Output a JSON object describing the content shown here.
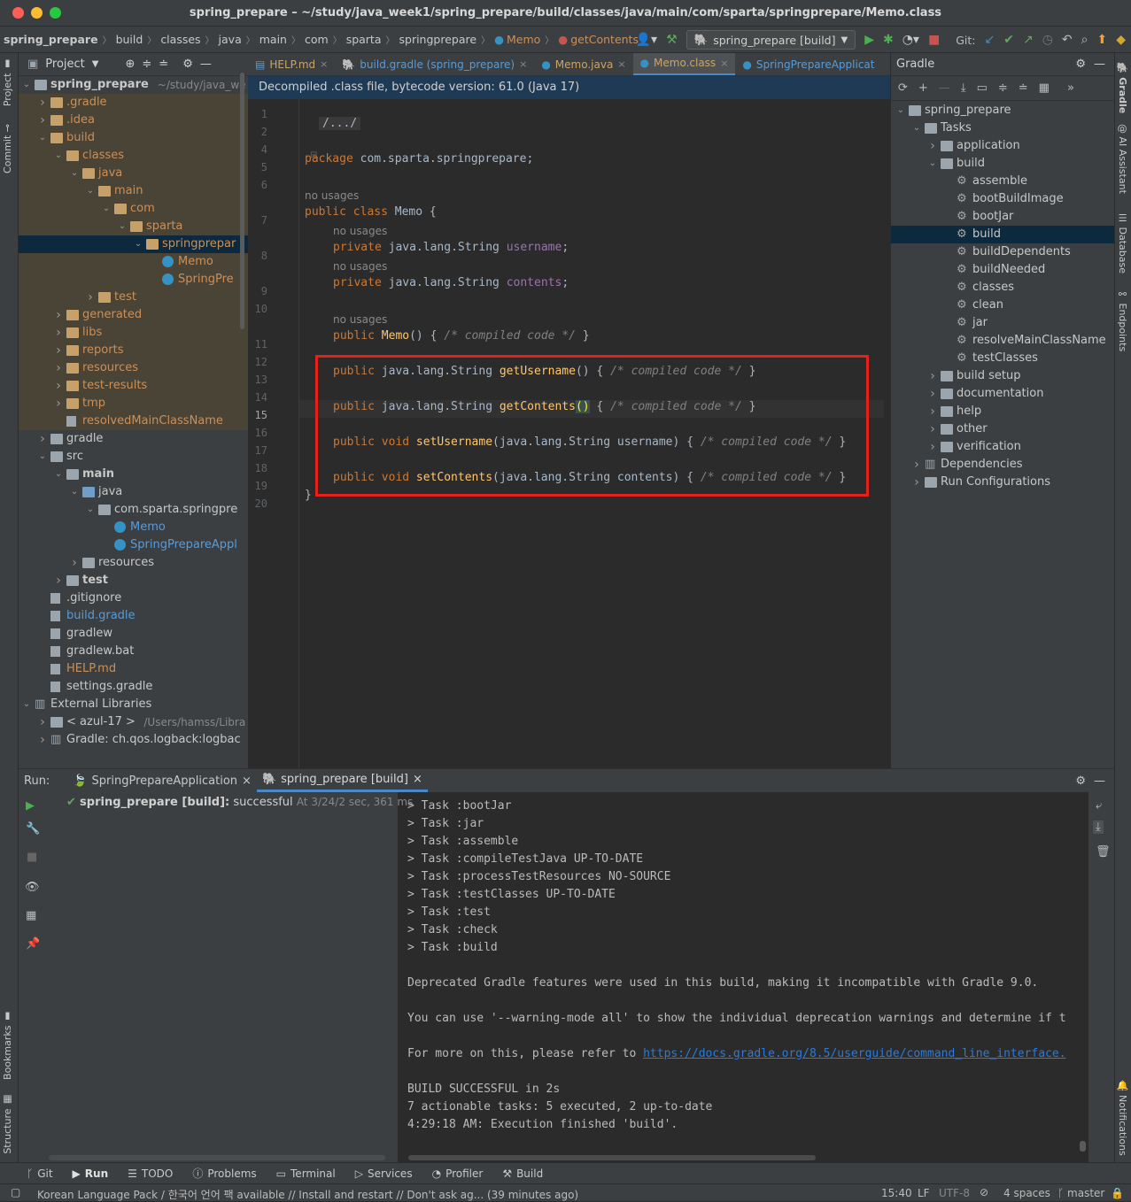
{
  "window": {
    "title": "spring_prepare – ~/study/java_week1/spring_prepare/build/classes/java/main/com/sparta/springprepare/Memo.class"
  },
  "navbar": {
    "crumbs": [
      "spring_prepare",
      "build",
      "classes",
      "java",
      "main",
      "com",
      "sparta",
      "springprepare"
    ],
    "crumb_class": "Memo",
    "crumb_method": "getContents",
    "run_config": "spring_prepare [build]",
    "git_label": "Git:"
  },
  "left_strip": {
    "project": "Project",
    "commit": "Commit",
    "bookmarks": "Bookmarks",
    "structure": "Structure"
  },
  "right_strip": {
    "gradle": "Gradle",
    "ai": "AI Assistant",
    "database": "Database",
    "endpoints": "Endpoints",
    "notifications": "Notifications"
  },
  "project": {
    "title": "Project",
    "items": [
      {
        "label": "spring_prepare",
        "extra": "~/study/java_we",
        "depth": 0,
        "arrow": "v",
        "icon": "folder-grey",
        "bold": true
      },
      {
        "label": ".gradle",
        "depth": 1,
        "arrow": ">",
        "icon": "folder",
        "hl": true,
        "orange": true
      },
      {
        "label": ".idea",
        "depth": 1,
        "arrow": ">",
        "icon": "folder",
        "hl": true,
        "orange": true
      },
      {
        "label": "build",
        "depth": 1,
        "arrow": "v",
        "icon": "folder",
        "hl": true,
        "orange": true
      },
      {
        "label": "classes",
        "depth": 2,
        "arrow": "v",
        "icon": "folder",
        "hl": true,
        "orange": true
      },
      {
        "label": "java",
        "depth": 3,
        "arrow": "v",
        "icon": "folder",
        "hl": true,
        "orange": true
      },
      {
        "label": "main",
        "depth": 4,
        "arrow": "v",
        "icon": "folder",
        "hl": true,
        "orange": true
      },
      {
        "label": "com",
        "depth": 5,
        "arrow": "v",
        "icon": "folder",
        "hl": true,
        "orange": true
      },
      {
        "label": "sparta",
        "depth": 6,
        "arrow": "v",
        "icon": "folder",
        "hl": true,
        "orange": true
      },
      {
        "label": "springprepar",
        "depth": 7,
        "arrow": "v",
        "icon": "folder",
        "sel": true,
        "orange": true
      },
      {
        "label": "Memo",
        "depth": 8,
        "arrow": "",
        "icon": "class",
        "hl": true,
        "orange": true
      },
      {
        "label": "SpringPre",
        "depth": 8,
        "arrow": "",
        "icon": "class",
        "hl": true,
        "orange": true
      },
      {
        "label": "test",
        "depth": 4,
        "arrow": ">",
        "icon": "folder",
        "hl": true,
        "orange": true
      },
      {
        "label": "generated",
        "depth": 2,
        "arrow": ">",
        "icon": "folder",
        "hl": true,
        "orange": true
      },
      {
        "label": "libs",
        "depth": 2,
        "arrow": ">",
        "icon": "folder",
        "hl": true,
        "orange": true
      },
      {
        "label": "reports",
        "depth": 2,
        "arrow": ">",
        "icon": "folder",
        "hl": true,
        "orange": true
      },
      {
        "label": "resources",
        "depth": 2,
        "arrow": ">",
        "icon": "folder",
        "hl": true,
        "orange": true
      },
      {
        "label": "test-results",
        "depth": 2,
        "arrow": ">",
        "icon": "folder",
        "hl": true,
        "orange": true
      },
      {
        "label": "tmp",
        "depth": 2,
        "arrow": ">",
        "icon": "folder",
        "hl": true,
        "orange": true
      },
      {
        "label": "resolvedMainClassName",
        "depth": 2,
        "arrow": "",
        "icon": "file",
        "hl": true,
        "orange": true
      },
      {
        "label": "gradle",
        "depth": 1,
        "arrow": ">",
        "icon": "folder-grey"
      },
      {
        "label": "src",
        "depth": 1,
        "arrow": "v",
        "icon": "folder-grey"
      },
      {
        "label": "main",
        "depth": 2,
        "arrow": "v",
        "icon": "folder-grey",
        "bold": true
      },
      {
        "label": "java",
        "depth": 3,
        "arrow": "v",
        "icon": "folder-blue"
      },
      {
        "label": "com.sparta.springpre",
        "depth": 4,
        "arrow": "v",
        "icon": "folder-grey"
      },
      {
        "label": "Memo",
        "depth": 5,
        "arrow": "",
        "icon": "class",
        "blue": true
      },
      {
        "label": "SpringPrepareAppl",
        "depth": 5,
        "arrow": "",
        "icon": "class",
        "blue": true
      },
      {
        "label": "resources",
        "depth": 3,
        "arrow": ">",
        "icon": "folder-grey"
      },
      {
        "label": "test",
        "depth": 2,
        "arrow": ">",
        "icon": "folder-grey",
        "bold": true
      },
      {
        "label": ".gitignore",
        "depth": 1,
        "arrow": "",
        "icon": "file"
      },
      {
        "label": "build.gradle",
        "depth": 1,
        "arrow": "",
        "icon": "file",
        "blue": true
      },
      {
        "label": "gradlew",
        "depth": 1,
        "arrow": "",
        "icon": "file"
      },
      {
        "label": "gradlew.bat",
        "depth": 1,
        "arrow": "",
        "icon": "file"
      },
      {
        "label": "HELP.md",
        "depth": 1,
        "arrow": "",
        "icon": "file",
        "orange": true
      },
      {
        "label": "settings.gradle",
        "depth": 1,
        "arrow": "",
        "icon": "file"
      },
      {
        "label": "External Libraries",
        "depth": 0,
        "arrow": "v",
        "icon": "lib"
      },
      {
        "label": "< azul-17 >",
        "extra": "/Users/hamss/Libra",
        "depth": 1,
        "arrow": ">",
        "icon": "folder-grey"
      },
      {
        "label": "Gradle: ch.qos.logback:logbac",
        "depth": 1,
        "arrow": ">",
        "icon": "lib"
      }
    ]
  },
  "editor": {
    "tabs": [
      {
        "label": "HELP.md",
        "active": false
      },
      {
        "label": "build.gradle (spring_prepare)",
        "active": false
      },
      {
        "label": "Memo.java",
        "active": false
      },
      {
        "label": "Memo.class",
        "active": true
      },
      {
        "label": "SpringPrepareApplicat",
        "active": false
      }
    ],
    "notice": "Decompiled .class file, bytecode version: 61.0 (Java 17)",
    "line_numbers": [
      "1",
      "2",
      "4",
      "5",
      "6",
      "7",
      "8",
      "9",
      "10",
      "11",
      "12",
      "13",
      "14",
      "15",
      "16",
      "17",
      "18",
      "19",
      "20"
    ],
    "hint": "no usages",
    "code": {
      "l2": "/.../",
      "l5_kw": "package",
      "l5_rest": " com.sparta.springprepare;",
      "l7_kw": "public class",
      "l7_rest": " Memo {",
      "l8_kw": "private",
      "l8_type": " java.lang.String ",
      "l8_field": "username",
      "l9_field": "contents",
      "l11_fn": "Memo",
      "l11_rest": "() { ",
      "compiled": "/* compiled code */",
      "l13_fn": "getUsername",
      "l15_fn": "getContents",
      "l17_kw": "public void",
      "l17_fn": "setUsername",
      "l17_params": "(java.lang.String username) { ",
      "l19_fn": "setContents",
      "l19_params": "(java.lang.String contents) { ",
      "l20": "}"
    }
  },
  "gradle": {
    "title": "Gradle",
    "items": [
      {
        "label": "spring_prepare",
        "depth": 0,
        "arrow": "v",
        "icon": "project"
      },
      {
        "label": "Tasks",
        "depth": 1,
        "arrow": "v",
        "icon": "folder"
      },
      {
        "label": "application",
        "depth": 2,
        "arrow": ">",
        "icon": "folder"
      },
      {
        "label": "build",
        "depth": 2,
        "arrow": "v",
        "icon": "folder"
      },
      {
        "label": "assemble",
        "depth": 3,
        "arrow": "",
        "icon": "gear"
      },
      {
        "label": "bootBuildImage",
        "depth": 3,
        "arrow": "",
        "icon": "gear"
      },
      {
        "label": "bootJar",
        "depth": 3,
        "arrow": "",
        "icon": "gear"
      },
      {
        "label": "build",
        "depth": 3,
        "arrow": "",
        "icon": "gear",
        "sel": true
      },
      {
        "label": "buildDependents",
        "depth": 3,
        "arrow": "",
        "icon": "gear"
      },
      {
        "label": "buildNeeded",
        "depth": 3,
        "arrow": "",
        "icon": "gear"
      },
      {
        "label": "classes",
        "depth": 3,
        "arrow": "",
        "icon": "gear"
      },
      {
        "label": "clean",
        "depth": 3,
        "arrow": "",
        "icon": "gear"
      },
      {
        "label": "jar",
        "depth": 3,
        "arrow": "",
        "icon": "gear"
      },
      {
        "label": "resolveMainClassName",
        "depth": 3,
        "arrow": "",
        "icon": "gear"
      },
      {
        "label": "testClasses",
        "depth": 3,
        "arrow": "",
        "icon": "gear"
      },
      {
        "label": "build setup",
        "depth": 2,
        "arrow": ">",
        "icon": "folder"
      },
      {
        "label": "documentation",
        "depth": 2,
        "arrow": ">",
        "icon": "folder"
      },
      {
        "label": "help",
        "depth": 2,
        "arrow": ">",
        "icon": "folder"
      },
      {
        "label": "other",
        "depth": 2,
        "arrow": ">",
        "icon": "folder"
      },
      {
        "label": "verification",
        "depth": 2,
        "arrow": ">",
        "icon": "folder"
      },
      {
        "label": "Dependencies",
        "depth": 1,
        "arrow": ">",
        "icon": "lib"
      },
      {
        "label": "Run Configurations",
        "depth": 1,
        "arrow": ">",
        "icon": "folder"
      }
    ]
  },
  "run": {
    "label": "Run:",
    "tabs": [
      {
        "label": "SpringPrepareApplication",
        "active": false
      },
      {
        "label": "spring_prepare [build]",
        "active": true
      }
    ],
    "tree_item": "spring_prepare [build]:",
    "tree_status": " successful",
    "tree_time": "At 3/24/",
    "tree_duration": "2 sec, 361 ms",
    "console": [
      "> Task :bootJar",
      "> Task :jar",
      "> Task :assemble",
      "> Task :compileTestJava UP-TO-DATE",
      "> Task :processTestResources NO-SOURCE",
      "> Task :testClasses UP-TO-DATE",
      "> Task :test",
      "> Task :check",
      "> Task :build",
      "",
      "Deprecated Gradle features were used in this build, making it incompatible with Gradle 9.0.",
      "",
      "You can use '--warning-mode all' to show the individual deprecation warnings and determine if t",
      "",
      "For more on this, please refer to ",
      "",
      "BUILD SUCCESSFUL in 2s",
      "7 actionable tasks: 5 executed, 2 up-to-date",
      "4:29:18 AM: Execution finished 'build'."
    ],
    "console_link": "https://docs.gradle.org/8.5/userguide/command_line_interface."
  },
  "bottom_tabs": [
    "Git",
    "Run",
    "TODO",
    "Problems",
    "Terminal",
    "Services",
    "Profiler",
    "Build"
  ],
  "status": {
    "message": "Korean Language Pack / 한국어 언어 팩 available // Install and restart // Don't ask ag... (39 minutes ago)",
    "position": "15:40",
    "line_sep": "LF",
    "encoding": "UTF-8",
    "indent": "4 spaces",
    "branch": "master"
  },
  "colors": {
    "accent": "#4a88c7",
    "highlight": "#e8201a",
    "keyword": "#cc7832",
    "method": "#ffc66d",
    "field": "#9876aa"
  }
}
